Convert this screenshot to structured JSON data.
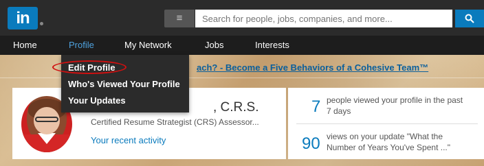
{
  "logo": {
    "text": "in"
  },
  "search": {
    "placeholder": "Search for people, jobs, companies, and more...",
    "menu_icon": "≡",
    "button_icon": "🔍"
  },
  "nav": {
    "items": [
      {
        "label": "Home"
      },
      {
        "label": "Profile"
      },
      {
        "label": "My Network"
      },
      {
        "label": "Jobs"
      },
      {
        "label": "Interests"
      }
    ]
  },
  "dropdown": {
    "items": [
      {
        "label": "Edit Profile"
      },
      {
        "label": "Who's Viewed Your Profile"
      },
      {
        "label": "Your Updates"
      }
    ]
  },
  "banner": {
    "text": "ach? - Become a Five Behaviors of a Cohesive Team™"
  },
  "profile": {
    "name_suffix": ", C.R.S.",
    "headline": "Certified Resume Strategist (CRS) Assessor...",
    "recent_activity": "Your recent activity"
  },
  "stats": [
    {
      "number": "7",
      "text": "people viewed your profile in the past 7 days"
    },
    {
      "number": "90",
      "text": "views on your update \"What the Number of Years You've Spent ...\""
    }
  ],
  "colors": {
    "accent": "#0a7bbd",
    "topbar": "#2b2b2b",
    "highlight": "#d01010"
  }
}
